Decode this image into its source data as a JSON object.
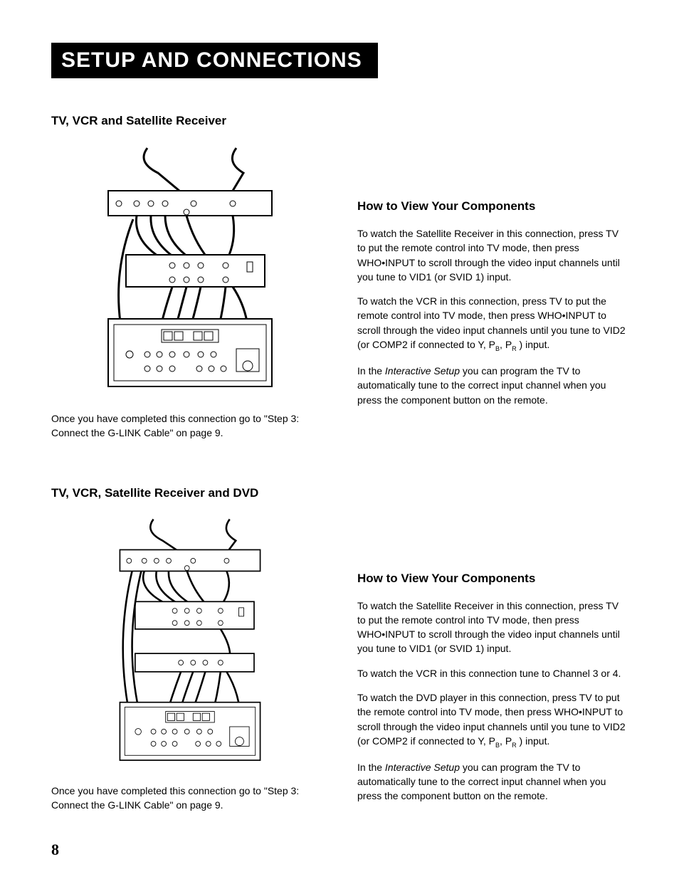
{
  "title": "Setup and Connections",
  "section1": {
    "heading": "TV,  VCR and Satellite Receiver",
    "caption": "Once you have completed this connection go to \"Step 3: Connect the G-LINK Cable\" on page 9.",
    "right_heading": "How to View Your Components",
    "p1": "To watch the Satellite Receiver in this connection, press TV to put the remote control into TV mode, then press WHO•INPUT to scroll through the video input channels until you tune to VID1 (or SVID 1) input.",
    "p2_pre": "To watch the VCR in this connection, press TV to put the remote control into TV mode, then press WHO•INPUT to scroll through the video input channels until you tune to VID2 (or COMP2 if connected to Y, P",
    "p2_sub1": "B",
    "p2_mid": ", P",
    "p2_sub2": "R",
    "p2_post": " ) input.",
    "p3_pre": "In the ",
    "p3_italic": "Interactive Setup",
    "p3_post": " you can program the TV to automatically tune to the correct input channel when you press the component button on the remote."
  },
  "section2": {
    "heading": "TV,  VCR, Satellite Receiver and DVD",
    "caption": "Once you have completed this connection go to \"Step 3: Connect the G-LINK Cable\" on page 9.",
    "right_heading": "How to View Your Components",
    "p1": "To watch the Satellite Receiver in this connection, press TV to put the remote control into TV mode, then press WHO•INPUT to scroll through the video input channels until you tune to VID1 (or SVID 1) input.",
    "p2": "To watch the VCR in this connection tune to Channel 3 or 4.",
    "p3_pre": "To watch the DVD player in this connection, press TV to put the remote control into TV mode, then press WHO•INPUT to scroll through the video input channels until you tune to VID2 (or COMP2 if connected to Y, P",
    "p3_sub1": "B",
    "p3_mid": ", P",
    "p3_sub2": "R",
    "p3_post": " ) input.",
    "p4_pre": "In the ",
    "p4_italic": "Interactive Setup",
    "p4_post": " you can program the TV to automatically tune to the correct input channel when you press the component button on the remote."
  },
  "page_number": "8"
}
